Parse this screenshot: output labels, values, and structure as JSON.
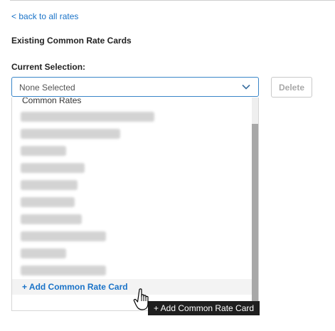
{
  "back_link": "< back to all rates",
  "section_title": "Existing Common Rate Cards",
  "field_label": "Current Selection:",
  "select": {
    "value": "None Selected",
    "icon": "chevron-down-icon"
  },
  "delete_button": "Delete",
  "dropdown": {
    "group_header": "Common Rates",
    "add_option": "+ Add Common Rate Card"
  },
  "tooltip": "+ Add Common Rate Card",
  "colors": {
    "link": "#1a73c8",
    "select_border": "#3a86c8",
    "tooltip_bg": "#1f1f1f"
  }
}
